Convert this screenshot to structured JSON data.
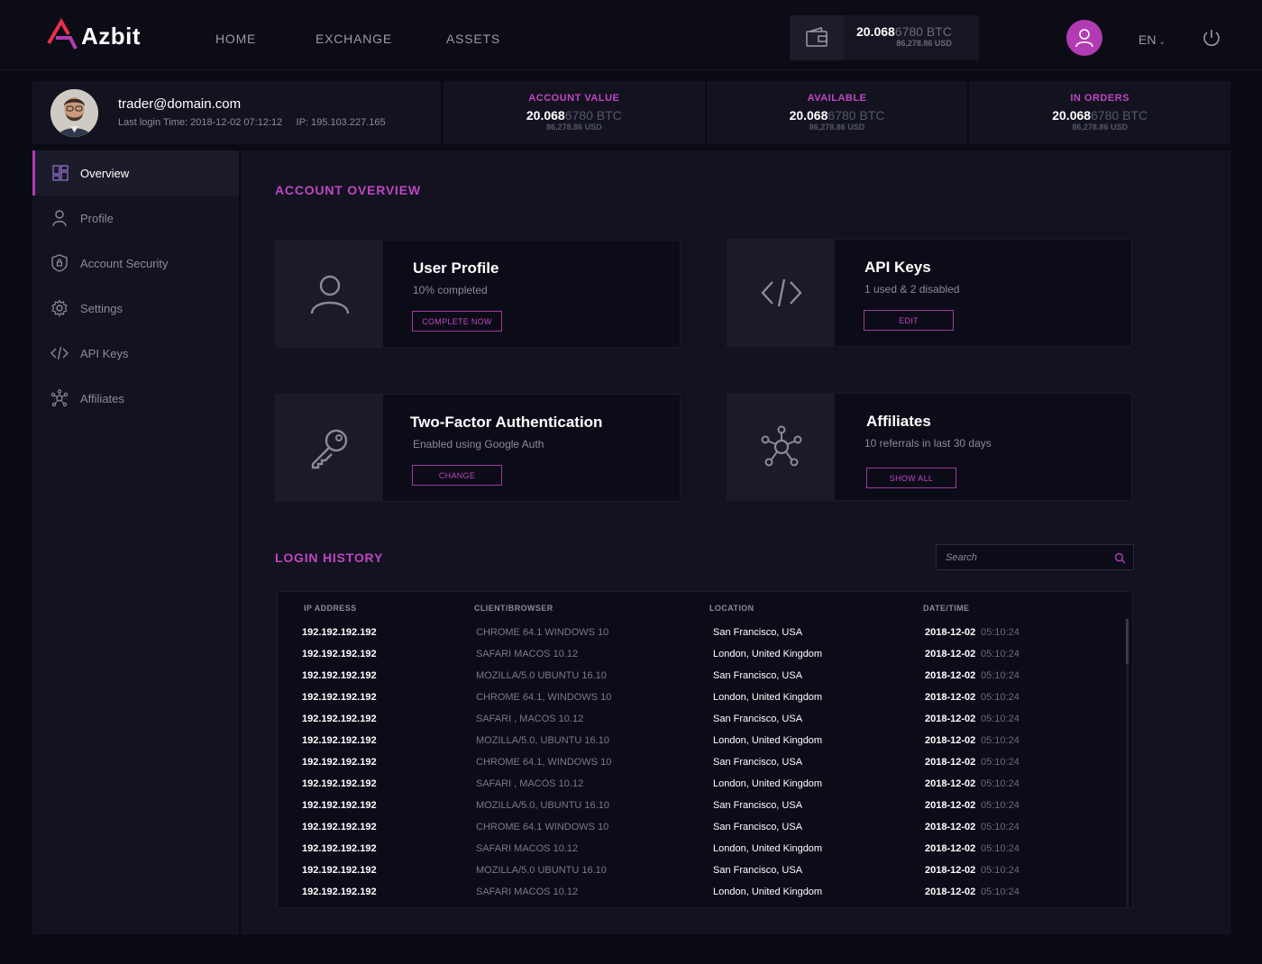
{
  "brand": {
    "name": "Azbit",
    "accent": "#b23bb2"
  },
  "nav": {
    "home": "HOME",
    "exchange": "EXCHANGE",
    "assets": "ASSETS"
  },
  "wallet": {
    "btc_bold": "20.068",
    "btc_dim": "6780 BTC",
    "usd": "86,278.86 USD",
    "icon": "wallet-icon"
  },
  "lang": {
    "current": "EN"
  },
  "user": {
    "email": "trader@domain.com",
    "last_login": "Last login Time: 2018-12-02 07:12:12",
    "ip": "IP: 195.103.227.165"
  },
  "stats": [
    {
      "title": "ACCOUNT VALUE",
      "bold": "20.068",
      "dim": "6780 BTC",
      "usd": "86,278.86 USD"
    },
    {
      "title": "AVAILABLE",
      "bold": "20.068",
      "dim": "6780 BTC",
      "usd": "86,278.86 USD"
    },
    {
      "title": "IN ORDERS",
      "bold": "20.068",
      "dim": "6780 BTC",
      "usd": "86,278.86 USD"
    }
  ],
  "sidebar": {
    "items": [
      {
        "label": "Overview",
        "icon": "dashboard-icon",
        "active": true
      },
      {
        "label": "Profile",
        "icon": "user-icon"
      },
      {
        "label": "Account Security",
        "icon": "shield-icon"
      },
      {
        "label": "Settings",
        "icon": "gear-icon"
      },
      {
        "label": "API Keys",
        "icon": "code-icon"
      },
      {
        "label": "Affiliates",
        "icon": "network-icon"
      }
    ]
  },
  "overview": {
    "title": "ACCOUNT OVERVIEW",
    "cards": [
      {
        "title": "User Profile",
        "sub": "10% completed",
        "button": "COMPLETE NOW",
        "icon": "user-icon"
      },
      {
        "title": "API Keys",
        "sub": "1 used & 2 disabled",
        "button": "EDIT",
        "icon": "code-icon"
      },
      {
        "title": "Two-Factor Authentication",
        "sub": "Enabled using Google Auth",
        "button": "CHANGE",
        "icon": "key-icon"
      },
      {
        "title": "Affiliates",
        "sub": "10 referrals in last 30 days",
        "button": "SHOW ALL",
        "icon": "network-icon"
      }
    ]
  },
  "history": {
    "title": "LOGIN HISTORY",
    "search_placeholder": "Search",
    "headers": [
      "IP ADDRESS",
      "CLIENT/BROWSER",
      "LOCATION",
      "DATE/TIME"
    ],
    "rows": [
      {
        "ip": "192.192.192.192",
        "client": "CHROME 64.1  WINDOWS 10",
        "location": "San Francisco, USA",
        "date": "2018-12-02",
        "time": "05:10:24"
      },
      {
        "ip": "192.192.192.192",
        "client": "SAFARI  MACOS 10.12",
        "location": "London, United Kingdom",
        "date": "2018-12-02",
        "time": "05:10:24"
      },
      {
        "ip": "192.192.192.192",
        "client": "MOZILLA/5.0 UBUNTU  16.10",
        "location": "San Francisco, USA",
        "date": "2018-12-02",
        "time": "05:10:24"
      },
      {
        "ip": "192.192.192.192",
        "client": "CHROME 64.1, WINDOWS 10",
        "location": "London, United Kingdom",
        "date": "2018-12-02",
        "time": "05:10:24"
      },
      {
        "ip": "192.192.192.192",
        "client": "SAFARI , MACOS 10.12",
        "location": "San Francisco, USA",
        "date": "2018-12-02",
        "time": "05:10:24"
      },
      {
        "ip": "192.192.192.192",
        "client": "MOZILLA/5.0, UBUNTU  16.10",
        "location": "London, United Kingdom",
        "date": "2018-12-02",
        "time": "05:10:24"
      },
      {
        "ip": "192.192.192.192",
        "client": "CHROME 64.1, WINDOWS 10",
        "location": "San Francisco, USA",
        "date": "2018-12-02",
        "time": "05:10:24"
      },
      {
        "ip": "192.192.192.192",
        "client": "SAFARI , MACOS 10.12",
        "location": "London, United Kingdom",
        "date": "2018-12-02",
        "time": "05:10:24"
      },
      {
        "ip": "192.192.192.192",
        "client": "MOZILLA/5.0, UBUNTU  16.10",
        "location": "San Francisco, USA",
        "date": "2018-12-02",
        "time": "05:10:24"
      },
      {
        "ip": "192.192.192.192",
        "client": "CHROME 64.1  WINDOWS 10",
        "location": "San Francisco, USA",
        "date": "2018-12-02",
        "time": "05:10:24"
      },
      {
        "ip": "192.192.192.192",
        "client": "SAFARI  MACOS 10.12",
        "location": "London, United Kingdom",
        "date": "2018-12-02",
        "time": "05:10:24"
      },
      {
        "ip": "192.192.192.192",
        "client": "MOZILLA/5.0 UBUNTU  16.10",
        "location": "San Francisco, USA",
        "date": "2018-12-02",
        "time": "05:10:24"
      },
      {
        "ip": "192.192.192.192",
        "client": "SAFARI  MACOS 10.12",
        "location": "London, United Kingdom",
        "date": "2018-12-02",
        "time": "05:10:24"
      }
    ]
  }
}
